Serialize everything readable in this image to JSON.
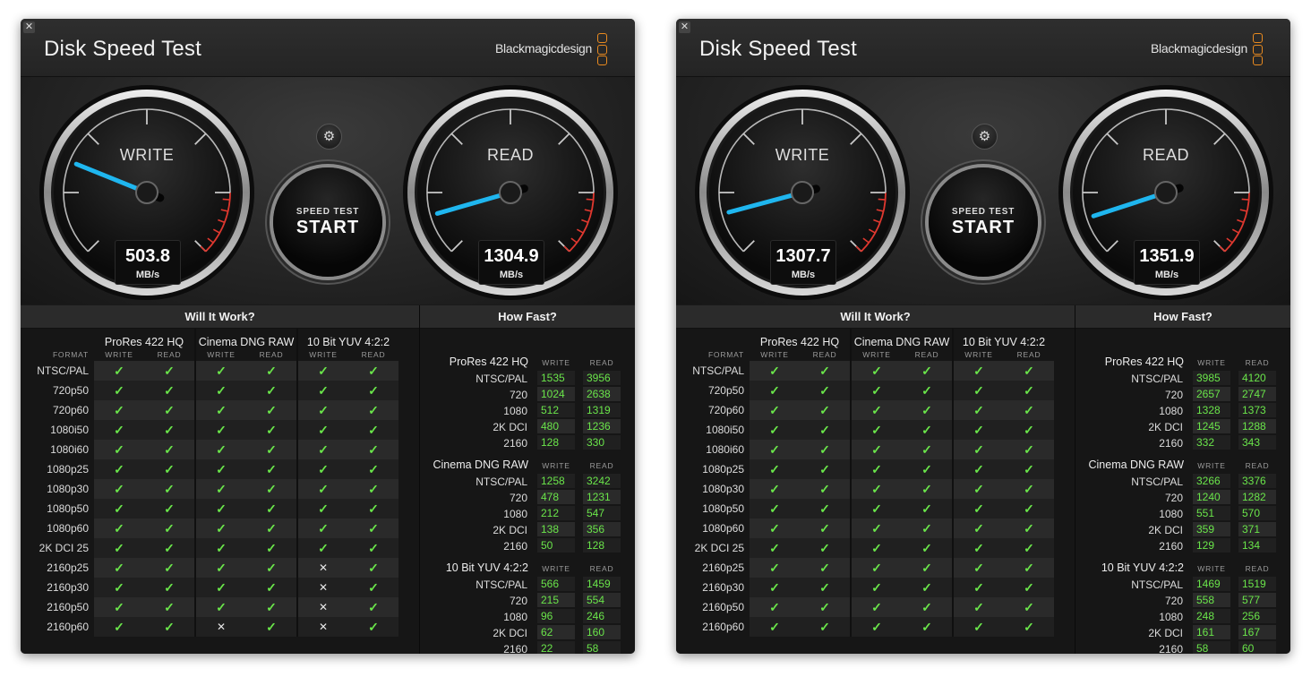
{
  "windows": [
    {
      "title": "Disk Speed Test",
      "brand": "Blackmagicdesign",
      "close_glyph": "✕",
      "gear_glyph": "⚙",
      "write_gauge": {
        "label": "WRITE",
        "value": "503.8",
        "unit": "MB/s",
        "needle_deg": 22
      },
      "read_gauge": {
        "label": "READ",
        "value": "1304.9",
        "unit": "MB/s",
        "needle_deg": -16
      },
      "start_button": {
        "small": "SPEED TEST",
        "big": "START"
      },
      "will_it_work": {
        "title": "Will It Work?",
        "format_label": "FORMAT",
        "codecs": [
          "ProRes 422 HQ",
          "Cinema DNG RAW",
          "10 Bit YUV 4:2:2"
        ],
        "sub_labels": [
          "WRITE",
          "READ"
        ],
        "rows": [
          {
            "format": "NTSC/PAL",
            "marks": [
              "✓",
              "✓",
              "✓",
              "✓",
              "✓",
              "✓"
            ]
          },
          {
            "format": "720p50",
            "marks": [
              "✓",
              "✓",
              "✓",
              "✓",
              "✓",
              "✓"
            ]
          },
          {
            "format": "720p60",
            "marks": [
              "✓",
              "✓",
              "✓",
              "✓",
              "✓",
              "✓"
            ]
          },
          {
            "format": "1080i50",
            "marks": [
              "✓",
              "✓",
              "✓",
              "✓",
              "✓",
              "✓"
            ]
          },
          {
            "format": "1080i60",
            "marks": [
              "✓",
              "✓",
              "✓",
              "✓",
              "✓",
              "✓"
            ]
          },
          {
            "format": "1080p25",
            "marks": [
              "✓",
              "✓",
              "✓",
              "✓",
              "✓",
              "✓"
            ]
          },
          {
            "format": "1080p30",
            "marks": [
              "✓",
              "✓",
              "✓",
              "✓",
              "✓",
              "✓"
            ]
          },
          {
            "format": "1080p50",
            "marks": [
              "✓",
              "✓",
              "✓",
              "✓",
              "✓",
              "✓"
            ]
          },
          {
            "format": "1080p60",
            "marks": [
              "✓",
              "✓",
              "✓",
              "✓",
              "✓",
              "✓"
            ]
          },
          {
            "format": "2K DCI 25",
            "marks": [
              "✓",
              "✓",
              "✓",
              "✓",
              "✓",
              "✓"
            ]
          },
          {
            "format": "2160p25",
            "marks": [
              "✓",
              "✓",
              "✓",
              "✓",
              "✕",
              "✓"
            ]
          },
          {
            "format": "2160p30",
            "marks": [
              "✓",
              "✓",
              "✓",
              "✓",
              "✕",
              "✓"
            ]
          },
          {
            "format": "2160p50",
            "marks": [
              "✓",
              "✓",
              "✓",
              "✓",
              "✕",
              "✓"
            ]
          },
          {
            "format": "2160p60",
            "marks": [
              "✓",
              "✓",
              "✕",
              "✓",
              "✕",
              "✓"
            ]
          }
        ]
      },
      "how_fast": {
        "title": "How Fast?",
        "sub_labels": [
          "WRITE",
          "READ"
        ],
        "groups": [
          {
            "codec": "ProRes 422 HQ",
            "rows": [
              {
                "format": "NTSC/PAL",
                "write": "1535",
                "read": "3956"
              },
              {
                "format": "720",
                "write": "1024",
                "read": "2638"
              },
              {
                "format": "1080",
                "write": "512",
                "read": "1319"
              },
              {
                "format": "2K DCI",
                "write": "480",
                "read": "1236"
              },
              {
                "format": "2160",
                "write": "128",
                "read": "330"
              }
            ]
          },
          {
            "codec": "Cinema DNG RAW",
            "rows": [
              {
                "format": "NTSC/PAL",
                "write": "1258",
                "read": "3242"
              },
              {
                "format": "720",
                "write": "478",
                "read": "1231"
              },
              {
                "format": "1080",
                "write": "212",
                "read": "547"
              },
              {
                "format": "2K DCI",
                "write": "138",
                "read": "356"
              },
              {
                "format": "2160",
                "write": "50",
                "read": "128"
              }
            ]
          },
          {
            "codec": "10 Bit YUV 4:2:2",
            "rows": [
              {
                "format": "NTSC/PAL",
                "write": "566",
                "read": "1459"
              },
              {
                "format": "720",
                "write": "215",
                "read": "554"
              },
              {
                "format": "1080",
                "write": "96",
                "read": "246"
              },
              {
                "format": "2K DCI",
                "write": "62",
                "read": "160"
              },
              {
                "format": "2160",
                "write": "22",
                "read": "58"
              }
            ]
          }
        ]
      }
    },
    {
      "title": "Disk Speed Test",
      "brand": "Blackmagicdesign",
      "close_glyph": "✕",
      "gear_glyph": "⚙",
      "write_gauge": {
        "label": "WRITE",
        "value": "1307.7",
        "unit": "MB/s",
        "needle_deg": -15
      },
      "read_gauge": {
        "label": "READ",
        "value": "1351.9",
        "unit": "MB/s",
        "needle_deg": -18
      },
      "start_button": {
        "small": "SPEED TEST",
        "big": "START"
      },
      "will_it_work": {
        "title": "Will It Work?",
        "format_label": "FORMAT",
        "codecs": [
          "ProRes 422 HQ",
          "Cinema DNG RAW",
          "10 Bit YUV 4:2:2"
        ],
        "sub_labels": [
          "WRITE",
          "READ"
        ],
        "rows": [
          {
            "format": "NTSC/PAL",
            "marks": [
              "✓",
              "✓",
              "✓",
              "✓",
              "✓",
              "✓"
            ]
          },
          {
            "format": "720p50",
            "marks": [
              "✓",
              "✓",
              "✓",
              "✓",
              "✓",
              "✓"
            ]
          },
          {
            "format": "720p60",
            "marks": [
              "✓",
              "✓",
              "✓",
              "✓",
              "✓",
              "✓"
            ]
          },
          {
            "format": "1080i50",
            "marks": [
              "✓",
              "✓",
              "✓",
              "✓",
              "✓",
              "✓"
            ]
          },
          {
            "format": "1080i60",
            "marks": [
              "✓",
              "✓",
              "✓",
              "✓",
              "✓",
              "✓"
            ]
          },
          {
            "format": "1080p25",
            "marks": [
              "✓",
              "✓",
              "✓",
              "✓",
              "✓",
              "✓"
            ]
          },
          {
            "format": "1080p30",
            "marks": [
              "✓",
              "✓",
              "✓",
              "✓",
              "✓",
              "✓"
            ]
          },
          {
            "format": "1080p50",
            "marks": [
              "✓",
              "✓",
              "✓",
              "✓",
              "✓",
              "✓"
            ]
          },
          {
            "format": "1080p60",
            "marks": [
              "✓",
              "✓",
              "✓",
              "✓",
              "✓",
              "✓"
            ]
          },
          {
            "format": "2K DCI 25",
            "marks": [
              "✓",
              "✓",
              "✓",
              "✓",
              "✓",
              "✓"
            ]
          },
          {
            "format": "2160p25",
            "marks": [
              "✓",
              "✓",
              "✓",
              "✓",
              "✓",
              "✓"
            ]
          },
          {
            "format": "2160p30",
            "marks": [
              "✓",
              "✓",
              "✓",
              "✓",
              "✓",
              "✓"
            ]
          },
          {
            "format": "2160p50",
            "marks": [
              "✓",
              "✓",
              "✓",
              "✓",
              "✓",
              "✓"
            ]
          },
          {
            "format": "2160p60",
            "marks": [
              "✓",
              "✓",
              "✓",
              "✓",
              "✓",
              "✓"
            ]
          }
        ]
      },
      "how_fast": {
        "title": "How Fast?",
        "sub_labels": [
          "WRITE",
          "READ"
        ],
        "groups": [
          {
            "codec": "ProRes 422 HQ",
            "rows": [
              {
                "format": "NTSC/PAL",
                "write": "3985",
                "read": "4120"
              },
              {
                "format": "720",
                "write": "2657",
                "read": "2747"
              },
              {
                "format": "1080",
                "write": "1328",
                "read": "1373"
              },
              {
                "format": "2K DCI",
                "write": "1245",
                "read": "1288"
              },
              {
                "format": "2160",
                "write": "332",
                "read": "343"
              }
            ]
          },
          {
            "codec": "Cinema DNG RAW",
            "rows": [
              {
                "format": "NTSC/PAL",
                "write": "3266",
                "read": "3376"
              },
              {
                "format": "720",
                "write": "1240",
                "read": "1282"
              },
              {
                "format": "1080",
                "write": "551",
                "read": "570"
              },
              {
                "format": "2K DCI",
                "write": "359",
                "read": "371"
              },
              {
                "format": "2160",
                "write": "129",
                "read": "134"
              }
            ]
          },
          {
            "codec": "10 Bit YUV 4:2:2",
            "rows": [
              {
                "format": "NTSC/PAL",
                "write": "1469",
                "read": "1519"
              },
              {
                "format": "720",
                "write": "558",
                "read": "577"
              },
              {
                "format": "1080",
                "write": "248",
                "read": "256"
              },
              {
                "format": "2K DCI",
                "write": "161",
                "read": "167"
              },
              {
                "format": "2160",
                "write": "58",
                "read": "60"
              }
            ]
          }
        ]
      }
    }
  ],
  "colors": {
    "accent_orange": "#e98a1f",
    "needle_blue": "#1fb6ef",
    "ok_green": "#6ae54a",
    "redline": "#e0382f"
  },
  "icons": {
    "close": "close-icon",
    "gear": "gear-icon",
    "check": "checkmark-icon",
    "cross": "cross-icon"
  }
}
